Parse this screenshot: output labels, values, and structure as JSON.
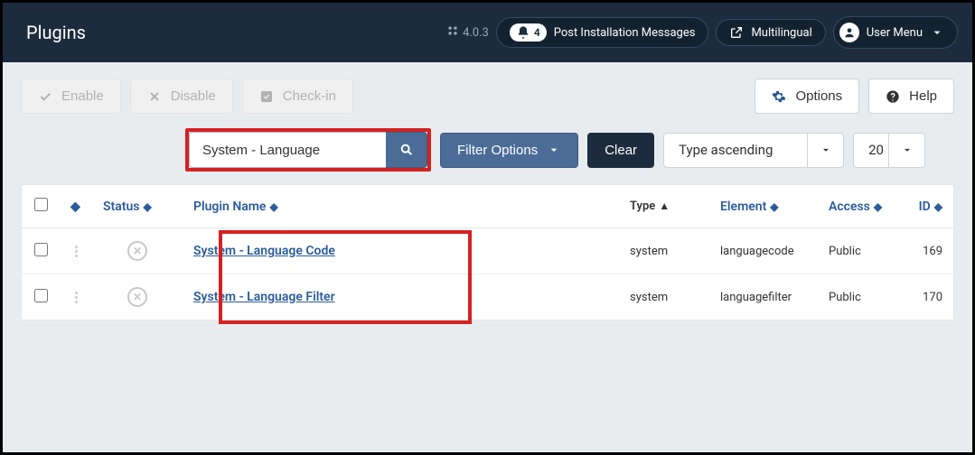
{
  "topbar": {
    "title": "Plugins",
    "version": "4.0.3",
    "notifications_count": "4",
    "notifications_label": "Post Installation Messages",
    "multilingual_label": "Multilingual",
    "usermenu_label": "User Menu"
  },
  "toolbar": {
    "enable": "Enable",
    "disable": "Disable",
    "checkin": "Check-in",
    "options": "Options",
    "help": "Help"
  },
  "search": {
    "value": "System - Language",
    "filter_label": "Filter Options",
    "clear_label": "Clear",
    "sort_label": "Type ascending",
    "limit_label": "20"
  },
  "table": {
    "headers": {
      "status": "Status",
      "name": "Plugin Name",
      "type": "Type",
      "element": "Element",
      "access": "Access",
      "id": "ID"
    },
    "rows": [
      {
        "name": "System - Language Code",
        "type": "system",
        "element": "languagecode",
        "access": "Public",
        "id": "169"
      },
      {
        "name": "System - Language Filter",
        "type": "system",
        "element": "languagefilter",
        "access": "Public",
        "id": "170"
      }
    ]
  }
}
